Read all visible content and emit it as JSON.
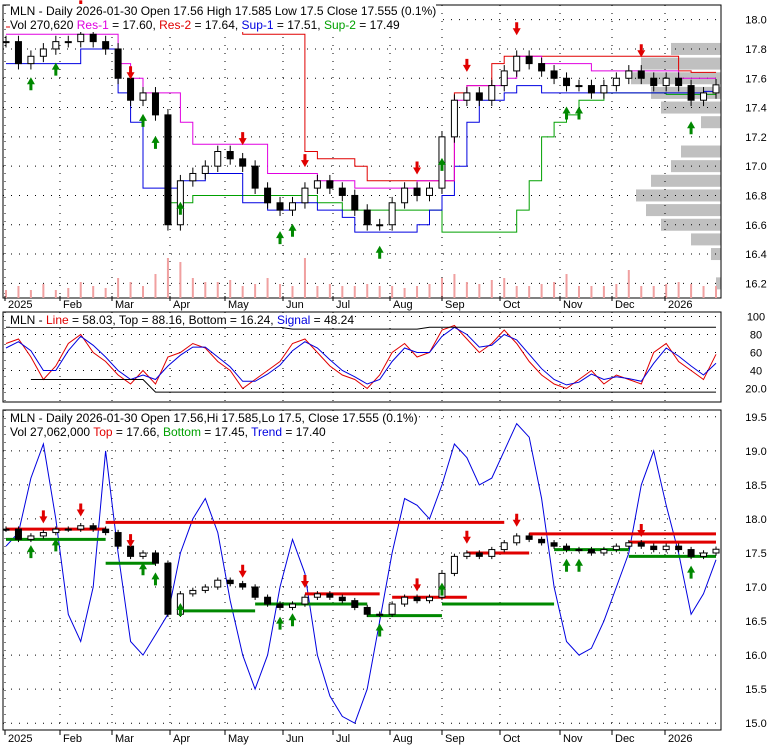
{
  "panel1": {
    "title": "MLN - Daily 2026-01-30 Open 17.56  High 17.585  Low 17.5  Close 17.555 (0.1%)",
    "vol": "Vol 270,620",
    "res1_label": "Res-1",
    "res1": " = 17.60, ",
    "res2_label": "Res-2",
    "res2": " = 17.64, ",
    "sup1_label": "Sup-1",
    "sup1": " = 17.51, ",
    "sup2_label": "Sup-2",
    "sup2": " = 17.49"
  },
  "panel2": {
    "prefix": "MLN - ",
    "line_label": "Line",
    "line": " = 58.03, Top = 88.16, Bottom = 16.24, ",
    "signal_label": "Signal",
    "signal": " = 48.24"
  },
  "panel3": {
    "title": "MLN - Daily 2026-01-30 Open 17.56,Hi 17.585,Lo 17.5, Close 17.555 (0.1%)",
    "vol": "Vol 27,062,000 ",
    "top_label": "Top",
    "top": " = 17.66, ",
    "bottom_label": "Bottom",
    "bottom": " = 17.45, ",
    "trend_label": "Trend",
    "trend": " = 17.40"
  },
  "colors": {
    "up": "#008800",
    "down": "#e00000",
    "res1": "#e000e0",
    "res2": "#e00000",
    "sup1": "#0000e0",
    "sup2": "#00a000",
    "grid": "#000000",
    "volume": "#f0a0a0",
    "profile": "#c0c0c0"
  },
  "chart_data": [
    {
      "type": "candlestick",
      "title": "MLN - Daily",
      "x_ticks": [
        "2025",
        "Feb",
        "Mar",
        "Apr",
        "May",
        "Jun",
        "Jul",
        "Aug",
        "Sep",
        "Oct",
        "Nov",
        "Dec",
        "2026"
      ],
      "y_ticks": [
        18.0,
        17.8,
        17.6,
        17.4,
        17.2,
        17.0,
        16.8,
        16.6,
        16.4,
        16.2
      ],
      "ylim": [
        16.1,
        18.1
      ],
      "weekly_close": [
        17.85,
        17.7,
        17.75,
        17.8,
        17.85,
        17.85,
        17.9,
        17.85,
        17.8,
        17.6,
        17.45,
        17.5,
        17.35,
        16.6,
        16.9,
        16.95,
        17.0,
        17.1,
        17.05,
        17.0,
        16.85,
        16.75,
        16.7,
        16.75,
        16.85,
        16.9,
        16.85,
        16.8,
        16.7,
        16.6,
        16.6,
        16.75,
        16.85,
        16.8,
        16.85,
        17.2,
        17.45,
        17.5,
        17.45,
        17.55,
        17.65,
        17.75,
        17.7,
        17.65,
        17.6,
        17.55,
        17.55,
        17.5,
        17.55,
        17.6,
        17.65,
        17.6,
        17.55,
        17.6,
        17.55,
        17.45,
        17.5,
        17.555
      ],
      "res1": [
        17.9,
        17.9,
        17.9,
        17.9,
        17.9,
        17.9,
        17.9,
        17.9,
        17.9,
        17.7,
        17.6,
        17.5,
        17.5,
        17.5,
        17.3,
        17.15,
        17.15,
        17.15,
        17.15,
        17.15,
        17.15,
        16.95,
        16.95,
        16.95,
        16.95,
        16.9,
        16.9,
        16.9,
        16.85,
        16.85,
        16.85,
        16.85,
        16.85,
        16.9,
        16.9,
        16.9,
        17.45,
        17.55,
        17.55,
        17.55,
        17.6,
        17.75,
        17.75,
        17.7,
        17.7,
        17.7,
        17.7,
        17.65,
        17.65,
        17.65,
        17.65,
        17.65,
        17.65,
        17.65,
        17.6,
        17.6,
        17.6,
        17.6
      ],
      "res2": [
        17.95,
        17.95,
        17.95,
        17.95,
        17.95,
        17.95,
        17.95,
        17.95,
        17.95,
        17.95,
        17.95,
        17.95,
        17.95,
        17.95,
        17.95,
        17.95,
        17.95,
        17.95,
        17.95,
        17.9,
        17.9,
        17.9,
        17.9,
        17.9,
        17.1,
        17.05,
        17.05,
        17.05,
        17.0,
        16.9,
        16.9,
        16.9,
        16.9,
        16.9,
        16.9,
        16.9,
        17.5,
        17.55,
        17.55,
        17.7,
        17.75,
        17.75,
        17.75,
        17.75,
        17.75,
        17.75,
        17.75,
        17.75,
        17.75,
        17.75,
        17.75,
        17.75,
        17.75,
        17.75,
        17.65,
        17.64,
        17.64,
        17.64
      ],
      "sup1": [
        17.7,
        17.7,
        17.7,
        17.7,
        17.7,
        17.7,
        17.8,
        17.8,
        17.8,
        17.5,
        17.3,
        16.85,
        16.85,
        16.85,
        16.9,
        16.9,
        16.95,
        16.95,
        16.95,
        16.75,
        16.75,
        16.7,
        16.7,
        16.75,
        16.75,
        16.7,
        16.7,
        16.65,
        16.55,
        16.55,
        16.55,
        16.55,
        16.55,
        16.6,
        16.7,
        16.8,
        17.0,
        17.3,
        17.45,
        17.45,
        17.5,
        17.55,
        17.55,
        17.5,
        17.5,
        17.5,
        17.5,
        17.5,
        17.5,
        17.5,
        17.5,
        17.5,
        17.5,
        17.5,
        17.5,
        17.5,
        17.51,
        17.51
      ],
      "sup2": [
        null,
        null,
        null,
        null,
        null,
        null,
        null,
        null,
        null,
        null,
        null,
        null,
        null,
        16.75,
        16.75,
        16.8,
        16.8,
        16.8,
        16.8,
        16.8,
        16.8,
        16.8,
        16.8,
        16.8,
        16.8,
        16.75,
        16.75,
        16.7,
        16.7,
        16.7,
        16.7,
        16.7,
        16.7,
        16.7,
        16.7,
        16.55,
        16.55,
        16.55,
        16.55,
        16.55,
        16.55,
        16.7,
        16.9,
        17.2,
        17.3,
        17.35,
        17.45,
        17.45,
        17.5,
        17.5,
        17.5,
        17.5,
        17.5,
        17.49,
        17.49,
        17.49,
        17.49,
        17.49
      ],
      "volume_rel": [
        0.2,
        0.3,
        0.2,
        0.35,
        0.2,
        0.25,
        0.4,
        0.3,
        0.25,
        0.5,
        0.4,
        0.3,
        0.6,
        1.0,
        0.9,
        0.5,
        0.4,
        0.4,
        0.45,
        0.3,
        0.35,
        0.5,
        0.35,
        0.3,
        1.0,
        0.3,
        0.35,
        0.3,
        0.3,
        0.35,
        0.3,
        0.3,
        0.25,
        0.3,
        0.35,
        0.5,
        0.6,
        0.4,
        0.35,
        0.45,
        0.5,
        0.3,
        0.3,
        0.35,
        0.4,
        0.6,
        0.3,
        0.3,
        0.3,
        0.35,
        0.7,
        0.3,
        0.3,
        0.35,
        0.4,
        0.35,
        0.3,
        0.3
      ],
      "profile": [
        [
          17.8,
          0.5
        ],
        [
          17.7,
          0.8
        ],
        [
          17.6,
          0.9
        ],
        [
          17.5,
          0.7
        ],
        [
          17.4,
          0.6
        ],
        [
          17.3,
          0.2
        ],
        [
          17.1,
          0.4
        ],
        [
          17.0,
          0.5
        ],
        [
          16.9,
          0.7
        ],
        [
          16.8,
          0.85
        ],
        [
          16.7,
          0.75
        ],
        [
          16.6,
          0.6
        ],
        [
          16.5,
          0.3
        ],
        [
          16.4,
          0.1
        ],
        [
          16.2,
          0.05
        ]
      ],
      "signals_down": [
        3,
        6,
        10,
        19,
        24,
        33,
        37,
        41,
        51
      ],
      "signals_up": [
        2,
        4,
        11,
        12,
        14,
        22,
        23,
        30,
        35,
        45,
        46,
        55
      ]
    },
    {
      "type": "line",
      "title": "MLN - Line/Signal",
      "y_ticks": [
        100,
        80,
        60,
        40,
        20
      ],
      "ylim": [
        5,
        105
      ],
      "series": [
        {
          "name": "Line",
          "color": "#e00000",
          "values": [
            70,
            75,
            55,
            30,
            45,
            70,
            80,
            60,
            50,
            35,
            25,
            40,
            25,
            55,
            60,
            70,
            65,
            50,
            40,
            20,
            30,
            40,
            50,
            70,
            75,
            60,
            45,
            35,
            30,
            20,
            35,
            60,
            70,
            55,
            60,
            85,
            90,
            75,
            60,
            70,
            85,
            70,
            50,
            35,
            25,
            20,
            30,
            40,
            25,
            35,
            30,
            25,
            60,
            70,
            50,
            40,
            30,
            58
          ]
        },
        {
          "name": "Signal",
          "color": "#0000e0",
          "values": [
            65,
            72,
            62,
            40,
            40,
            62,
            78,
            68,
            55,
            40,
            30,
            35,
            30,
            45,
            57,
            66,
            66,
            55,
            44,
            28,
            28,
            36,
            46,
            62,
            72,
            65,
            52,
            40,
            33,
            25,
            30,
            50,
            65,
            60,
            60,
            78,
            88,
            80,
            66,
            68,
            80,
            74,
            58,
            42,
            30,
            24,
            27,
            36,
            30,
            33,
            31,
            28,
            48,
            65,
            56,
            45,
            35,
            48
          ]
        },
        {
          "name": "Top",
          "color": "#000000",
          "values": [
            88,
            88,
            88,
            88,
            88,
            88,
            88,
            88,
            88,
            88,
            88,
            88,
            88,
            88,
            88,
            88,
            88,
            88,
            88,
            88,
            88,
            88,
            88,
            86,
            86,
            86,
            86,
            86,
            86,
            86,
            86,
            86,
            86,
            86,
            88,
            88,
            88,
            88,
            88,
            88,
            88,
            88,
            88,
            88,
            88,
            88,
            88,
            88,
            88,
            88,
            88,
            88,
            88,
            88,
            88,
            88,
            88,
            88
          ]
        },
        {
          "name": "Bottom",
          "color": "#000000",
          "values": [
            null,
            null,
            30,
            30,
            30,
            30,
            30,
            30,
            30,
            30,
            30,
            30,
            16,
            16,
            16,
            16,
            16,
            16,
            16,
            16,
            16,
            16,
            16,
            16,
            16,
            16,
            16,
            16,
            16,
            16,
            16,
            16,
            16,
            16,
            16,
            16,
            16,
            16,
            16,
            16,
            16,
            16,
            16,
            16,
            16,
            16,
            16,
            16,
            16,
            16,
            16,
            16,
            16,
            16,
            16,
            16,
            16,
            16
          ]
        }
      ]
    },
    {
      "type": "line",
      "title": "MLN - Daily Trend",
      "y_ticks": [
        19.5,
        19.0,
        18.5,
        18.0,
        17.5,
        17.0,
        16.5,
        16.0,
        15.5,
        15.0
      ],
      "ylim": [
        14.9,
        19.6
      ],
      "trend": [
        17.6,
        17.8,
        18.6,
        19.1,
        18.0,
        16.6,
        16.2,
        17.0,
        19.0,
        17.5,
        16.2,
        16.0,
        16.3,
        16.6,
        17.5,
        18.0,
        18.3,
        17.8,
        16.8,
        16.0,
        15.5,
        16.0,
        17.0,
        17.7,
        17.2,
        16.0,
        15.4,
        15.1,
        15.0,
        15.5,
        16.5,
        17.5,
        18.3,
        18.2,
        18.0,
        18.5,
        19.1,
        18.9,
        18.5,
        18.6,
        19.0,
        19.4,
        19.2,
        18.3,
        17.0,
        16.2,
        16.0,
        16.1,
        16.5,
        17.0,
        17.5,
        18.5,
        19.0,
        18.2,
        17.5,
        16.6,
        16.9,
        17.4
      ],
      "tops": [
        [
          0,
          8,
          17.85
        ],
        [
          8,
          40,
          17.95
        ],
        [
          24,
          30,
          16.9
        ],
        [
          31,
          37,
          16.85
        ],
        [
          37,
          42,
          17.5
        ],
        [
          42,
          57,
          17.78
        ],
        [
          50,
          57,
          17.66
        ]
      ],
      "bottoms": [
        [
          0,
          8,
          17.7
        ],
        [
          8,
          12,
          17.35
        ],
        [
          14,
          20,
          16.65
        ],
        [
          20,
          29,
          16.75
        ],
        [
          29,
          35,
          16.58
        ],
        [
          35,
          44,
          16.75
        ],
        [
          44,
          50,
          17.55
        ],
        [
          50,
          57,
          17.45
        ]
      ]
    }
  ]
}
